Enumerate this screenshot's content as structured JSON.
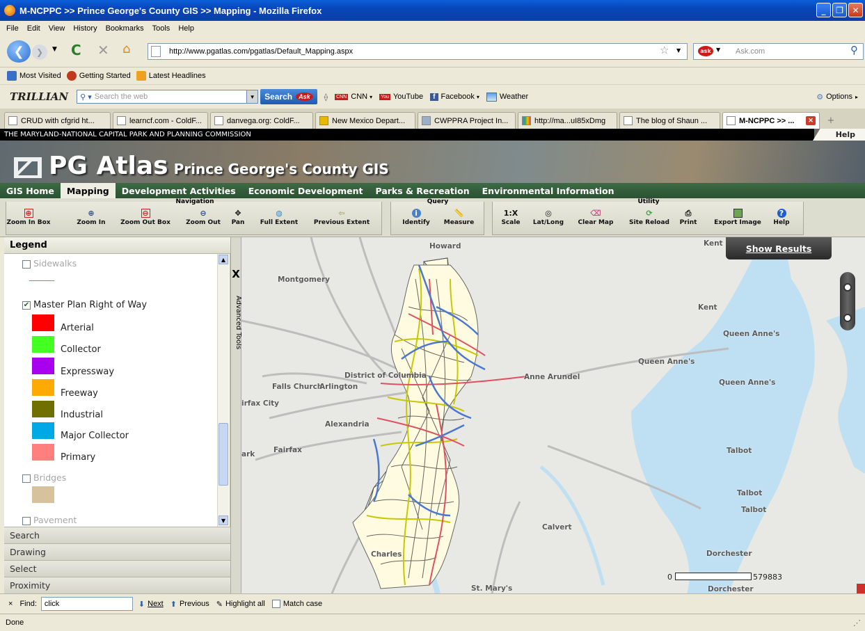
{
  "window": {
    "title": "M-NCPPC >> Prince George's County GIS >> Mapping - Mozilla Firefox"
  },
  "menu": [
    "File",
    "Edit",
    "View",
    "History",
    "Bookmarks",
    "Tools",
    "Help"
  ],
  "address": {
    "url": "http://www.pgatlas.com/pgatlas/Default_Mapping.aspx",
    "search_placeholder": "Ask.com"
  },
  "bookmarks": [
    {
      "label": "Most Visited",
      "color": "#3a6fc9"
    },
    {
      "label": "Getting Started",
      "color": "#c0391b"
    },
    {
      "label": "Latest Headlines",
      "color": "#f0a020"
    }
  ],
  "trillian": {
    "brand": "TRILLIAN",
    "search_placeholder": "Search the web",
    "search_button": "Search",
    "ask_badge": "Ask",
    "links": [
      "CNN",
      "YouTube",
      "Facebook",
      "Weather"
    ],
    "options": "Options"
  },
  "tabs": [
    "CRUD with cfgrid ht...",
    "learncf.com - ColdF...",
    "danvega.org: ColdF...",
    "New Mexico Depart...",
    "CWPPRA Project In...",
    "http://ma...uI85xDmg",
    "The blog of Shaun ...",
    "M-NCPPC >> ..."
  ],
  "site": {
    "commission": "THE MARYLAND-NATIONAL CAPITAL PARK AND PLANNING COMMISSION",
    "help": "Help",
    "logo_main": "PG Atlas",
    "logo_sub": "Prince George's County GIS",
    "nav": [
      "GIS Home",
      "Mapping",
      "Development Activities",
      "Economic Development",
      "Parks & Recreation",
      "Environmental Information"
    ],
    "nav_active": "Mapping"
  },
  "toolbar": {
    "groups": {
      "navigation": "Navigation",
      "query": "Query",
      "utility": "Utility"
    },
    "navigation": [
      "Zoom In Box",
      "Zoom In",
      "Zoom Out Box",
      "Zoom Out",
      "Pan",
      "Full Extent",
      "Previous Extent"
    ],
    "query": [
      "Identify",
      "Measure"
    ],
    "utility": [
      "Scale",
      "Lat/Long",
      "Clear Map",
      "Site Reload",
      "Print",
      "Export Image",
      "Help"
    ],
    "scale_icon_text": "1:X"
  },
  "legend": {
    "title": "Legend",
    "layers": [
      {
        "label": "Sidewalks",
        "checked": false,
        "dim": true
      },
      {
        "label": "Master Plan Right of Way",
        "checked": true,
        "dim": false
      },
      {
        "label": "Bridges",
        "checked": false,
        "dim": true
      },
      {
        "label": "Pavement",
        "checked": false,
        "dim": true
      }
    ],
    "row_items": [
      {
        "label": "Arterial",
        "color": "#ff0000"
      },
      {
        "label": "Collector",
        "color": "#44ff22"
      },
      {
        "label": "Expressway",
        "color": "#a800ee"
      },
      {
        "label": "Freeway",
        "color": "#ffaa00"
      },
      {
        "label": "Industrial",
        "color": "#707000"
      },
      {
        "label": "Major Collector",
        "color": "#00a8e6"
      },
      {
        "label": "Primary",
        "color": "#ff7f7f"
      }
    ],
    "bridges_color": "#d7c29e",
    "sidewalk_line_color": "#e06070"
  },
  "accordion": [
    "Search",
    "Drawing",
    "Select",
    "Proximity"
  ],
  "advanced_tools": {
    "close": "X",
    "label": "Advanced Tools"
  },
  "map": {
    "show_results": "Show Results",
    "labels": [
      "Howard",
      "Montgomery",
      "Kent",
      "Kent",
      "Queen Anne's",
      "Queen Anne's",
      "Queen Anne's",
      "District of Columbia",
      "Anne Arundel",
      "Falls Church",
      "Arlington",
      "irfax City",
      "Alexandria",
      "Fairfax",
      "ark",
      "Calvert",
      "Talbot",
      "Talbot",
      "Talbot",
      "Charles",
      "Dorchester",
      "St. Mary's",
      "Dorchester"
    ],
    "scale_min": "0",
    "scale_max": "579883"
  },
  "findbar": {
    "close": "×",
    "label": "Find:",
    "value": "click",
    "next": "Next",
    "previous": "Previous",
    "highlight": "Highlight all",
    "match": "Match case"
  },
  "status": "Done"
}
